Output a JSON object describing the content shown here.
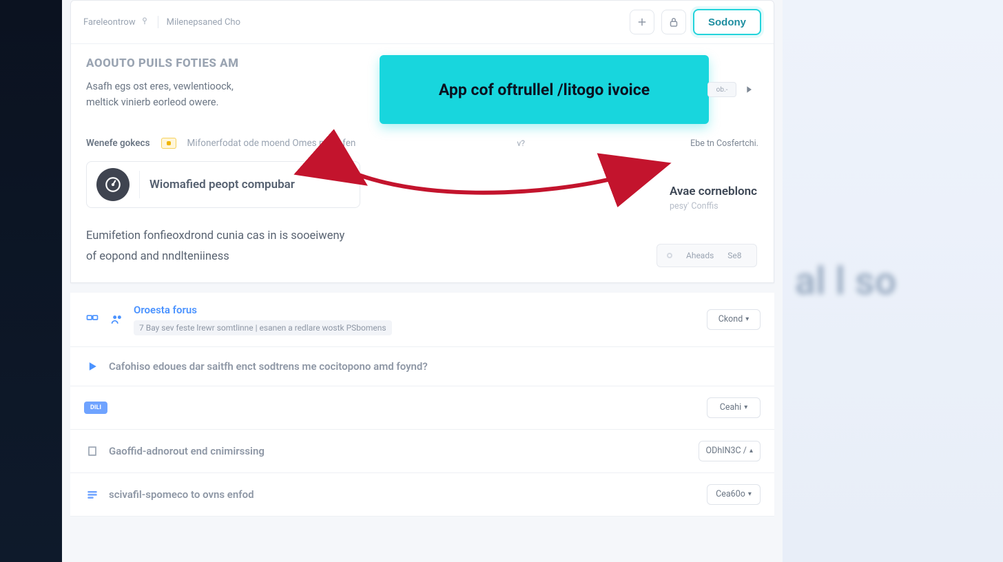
{
  "breadcrumb": {
    "a": "Fareleontrow",
    "b": "Milenepsaned Cho"
  },
  "top": {
    "primary_label": "Sodony"
  },
  "header": {
    "title": "AOOUTO PUILS FOTIES AM",
    "sub_l1": "Asafh egs ost eres, vewlentioock,",
    "sub_l2": "meltick vinierb eorleod owere."
  },
  "callout": {
    "text": "App cof oftrullel /litogo ivoice",
    "chip": "ob.-"
  },
  "filter": {
    "label": "Wenefe gokecs",
    "desc": "Mifonerfodat ode moend Omes nemt fen",
    "right_link": "Ebe tn Cosfertchi."
  },
  "combo": {
    "text": "Wiomafied peopt compubar"
  },
  "right_info": {
    "t1": "Avae corneblonc",
    "t2": "pesy' Conffis"
  },
  "paragraph": {
    "l1": "Eumifetion fonfieoxdrond cunia cas in is sooeiweny",
    "l2": "of eopond and nndlteniiness"
  },
  "status": {
    "a": "Aheads",
    "b": "Se8"
  },
  "rows": [
    {
      "kind": "header-row",
      "icon": "calendar-group-icon",
      "title_color": "accent-blue",
      "title": "Oroesta forus",
      "sub": "7 Bay sev feste lrewr somtlinne | esanen a redlare wostk PSbomens",
      "btn": "Ckond"
    },
    {
      "kind": "question-row",
      "icon": "play-icon",
      "title_color": "accent-grey",
      "title": "Cafohiso edoues dar saitfh enct sodtrens me cocitopono amd foynd?",
      "btn": null
    },
    {
      "kind": "tag-row",
      "icon": "tag-icon",
      "title_color": "",
      "title": "DILI",
      "btn": "Ceahi"
    },
    {
      "kind": "item-row",
      "icon": "building-icon",
      "title_color": "accent-grey",
      "title": "Gaoffid-adnorout end cnimirssing",
      "btn": "ODhIN3C /"
    },
    {
      "kind": "item-row",
      "icon": "list-icon",
      "title_color": "accent-grey",
      "title": "scivafil-spomeco to ovns enfod",
      "btn": "Cea60o"
    }
  ],
  "right_ghost": "al l so"
}
